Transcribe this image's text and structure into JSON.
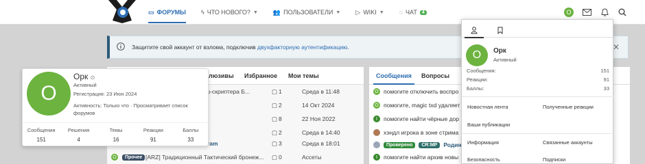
{
  "header": {
    "nav": [
      {
        "label": "ФОРУМЫ",
        "icon": "forums-icon"
      },
      {
        "label": "ЧТО НОВОГО?",
        "icon": "whats-new-icon"
      },
      {
        "label": "ПОЛЬЗОВАТЕЛИ",
        "icon": "users-icon"
      },
      {
        "label": "WIKI",
        "icon": "wiki-icon"
      },
      {
        "label": "ЧАТ",
        "icon": "chat-icon",
        "badge": "4"
      }
    ],
    "avatar_letter": "O"
  },
  "alert": {
    "text_before": "Защитите свой аккаунт от взлома, подключив ",
    "link": "двухфакторную аутентификацию",
    "text_after": "."
  },
  "left_panel": {
    "tabs": [
      "люзивы",
      "Избранное",
      "Мои темы"
    ],
    "rows": [
      {
        "title": "треш-скриптера Б...",
        "replies": "1",
        "date": "Среда в 11:48"
      },
      {
        "title": "",
        "replies": "2",
        "date": "14 Окт 2024"
      },
      {
        "title": "н]",
        "replies": "8",
        "date": "22 Ноя 2022"
      },
      {
        "title": "]",
        "replies": "2",
        "date": "Среда в 14:40"
      },
      {
        "title": "ram",
        "replies": "3",
        "date": "Среда в 18:01"
      },
      {
        "title": "[ARZ] Традиционный Тактический бронеж...",
        "replies": "0",
        "date": "Ассеты",
        "tag": "Прочее",
        "avatar": "O"
      }
    ]
  },
  "right_panel": {
    "tabs": [
      "Сообщения",
      "Вопросы"
    ],
    "rows": [
      {
        "text": "помогите отключить воспро",
        "avatar": "O"
      },
      {
        "text": "помогите, magic txd удаляет",
        "avatar": "O"
      },
      {
        "text": "помогите найти чёрные дор",
        "avatar": "I"
      },
      {
        "text": "хэндл игрока в зоне стрима",
        "avatar": ""
      },
      {
        "text": "Родина со",
        "avatar": "",
        "tags": [
          "Проверено",
          "CR:MP"
        ]
      },
      {
        "text": "помогите найти архив новы",
        "avatar": "I"
      }
    ]
  },
  "profile_card": {
    "avatar_letter": "O",
    "name": "Орк",
    "status": "Активный",
    "registration": "Регистрация: 23 Июн 2024",
    "activity": "Активность: Только что · Просматривает список форумов",
    "stats": [
      {
        "label": "Сообщения",
        "value": "151"
      },
      {
        "label": "Решения",
        "value": "4"
      },
      {
        "label": "Темы",
        "value": "16"
      },
      {
        "label": "Реакции",
        "value": "91"
      },
      {
        "label": "Баллы",
        "value": "33"
      }
    ]
  },
  "account_menu": {
    "avatar_letter": "O",
    "name": "Орк",
    "status": "Активный",
    "stats": [
      {
        "label": "Сообщения:",
        "value": "151"
      },
      {
        "label": "Реакции:",
        "value": "91"
      },
      {
        "label": "Баллы:",
        "value": "33"
      }
    ],
    "links": [
      [
        "Новостная лента",
        "Полученные реакции"
      ],
      [
        "Ваши публикации",
        ""
      ],
      [
        "Информация",
        "Связанные аккаунты"
      ],
      [
        "Безопасность",
        "Подписки"
      ]
    ]
  }
}
